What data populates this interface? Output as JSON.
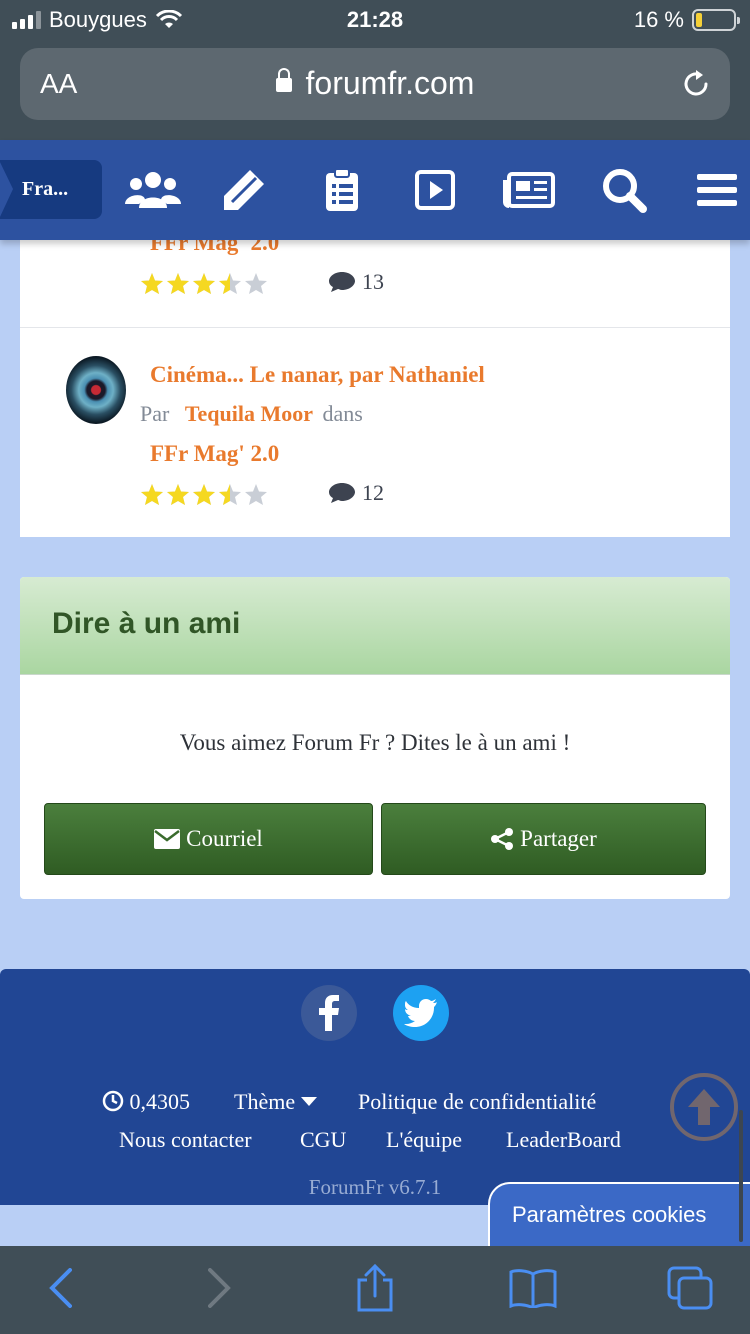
{
  "status_bar": {
    "carrier": "Bouygues",
    "time": "21:28",
    "battery": "16 %",
    "battery_level": 0.16
  },
  "browser": {
    "text_size_label": "AA",
    "domain": "forumfr.com"
  },
  "site_nav": {
    "breadcrumb": "Fra...",
    "icons": [
      "members-icon",
      "pen-icon",
      "clipboard-icon",
      "video-icon",
      "newspaper-icon",
      "search-icon",
      "menu-icon"
    ]
  },
  "articles": [
    {
      "forum": "FFr Mag' 2.0",
      "rating": 3.5,
      "comments": "13"
    },
    {
      "title": "Cinéma... Le nanar, par Nathaniel",
      "by_label": "Par",
      "author": "Tequila Moor",
      "in_label": "dans",
      "forum": "FFr Mag' 2.0",
      "rating": 3.5,
      "comments": "12"
    }
  ],
  "share_widget": {
    "title": "Dire à un ami",
    "text": "Vous aimez Forum Fr ? Dites le à un ami !",
    "email_button": "Courriel",
    "share_button": "Partager"
  },
  "footer": {
    "load_time": "0,4305",
    "theme": "Thème",
    "privacy": "Politique de confidentialité",
    "contact": "Nous contacter",
    "cgu": "CGU",
    "team": "L'équipe",
    "leaderboard": "LeaderBoard",
    "version": "ForumFr v6.7.1",
    "cookies": "Paramètres cookies"
  },
  "colors": {
    "nav": "#2d52a0",
    "accent": "#e97a2d",
    "button": "#3a6b2d",
    "footer": "#214694",
    "star": "#f5d821"
  }
}
